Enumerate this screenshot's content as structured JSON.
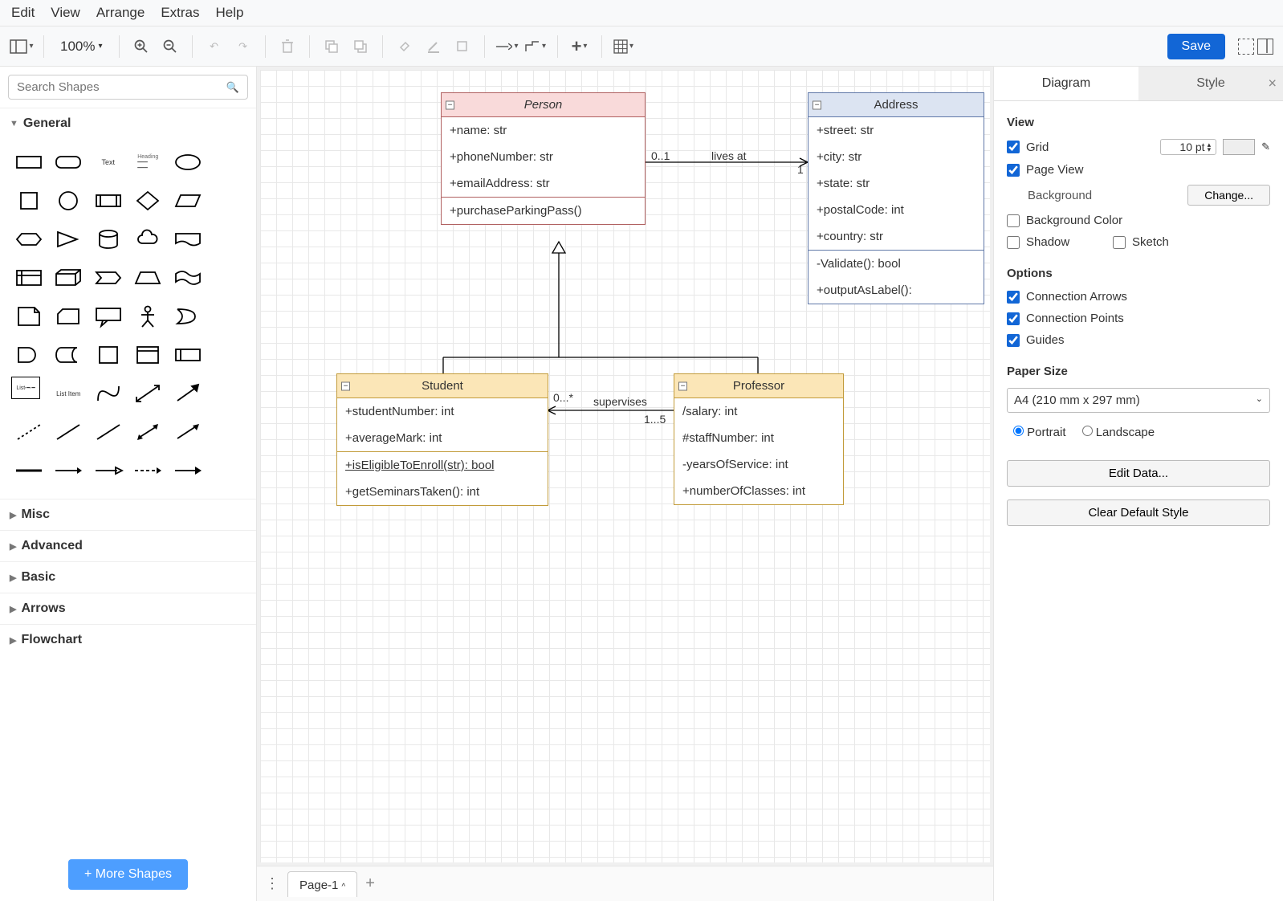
{
  "menu": [
    "Edit",
    "View",
    "Arrange",
    "Extras",
    "Help"
  ],
  "toolbar": {
    "zoom": "100%",
    "save": "Save"
  },
  "search": {
    "placeholder": "Search Shapes"
  },
  "sections": {
    "general": "General",
    "collapsed": [
      "Misc",
      "Advanced",
      "Basic",
      "Arrows",
      "Flowchart"
    ]
  },
  "more_shapes": "+ More Shapes",
  "pages": {
    "tab": "Page-1"
  },
  "classes": {
    "person": {
      "title": "Person",
      "attrs": [
        "+name: str",
        "+phoneNumber: str",
        "+emailAddress: str"
      ],
      "ops": [
        "+purchaseParkingPass()"
      ]
    },
    "address": {
      "title": "Address",
      "attrs": [
        "+street: str",
        "+city: str",
        "+state: str",
        "+postalCode: int",
        "+country: str"
      ],
      "ops": [
        "-Validate(): bool",
        "+outputAsLabel():"
      ]
    },
    "student": {
      "title": "Student",
      "attrs": [
        "+studentNumber: int",
        "+averageMark: int"
      ],
      "ops": [
        "+isEligibleToEnroll(str): bool",
        "+getSeminarsTaken(): int"
      ]
    },
    "professor": {
      "title": "Professor",
      "attrs": [
        "/salary: int",
        "#staffNumber: int",
        "-yearsOfService: int",
        "+numberOfClasses: int"
      ]
    }
  },
  "edges": {
    "lives_at": {
      "label": "lives at",
      "src": "0..1",
      "dst": "1"
    },
    "supervises": {
      "label": "supervises",
      "src": "0...*",
      "dst": "1...5"
    }
  },
  "format": {
    "tabs": {
      "diagram": "Diagram",
      "style": "Style"
    },
    "view": {
      "title": "View",
      "grid": "Grid",
      "grid_size": "10 pt",
      "page_view": "Page View",
      "background": "Background",
      "change": "Change...",
      "bg_color": "Background Color",
      "shadow": "Shadow",
      "sketch": "Sketch"
    },
    "options": {
      "title": "Options",
      "conn_arrows": "Connection Arrows",
      "conn_points": "Connection Points",
      "guides": "Guides"
    },
    "paper": {
      "title": "Paper Size",
      "size": "A4 (210 mm x 297 mm)",
      "portrait": "Portrait",
      "landscape": "Landscape"
    },
    "edit_data": "Edit Data...",
    "clear_style": "Clear Default Style"
  }
}
